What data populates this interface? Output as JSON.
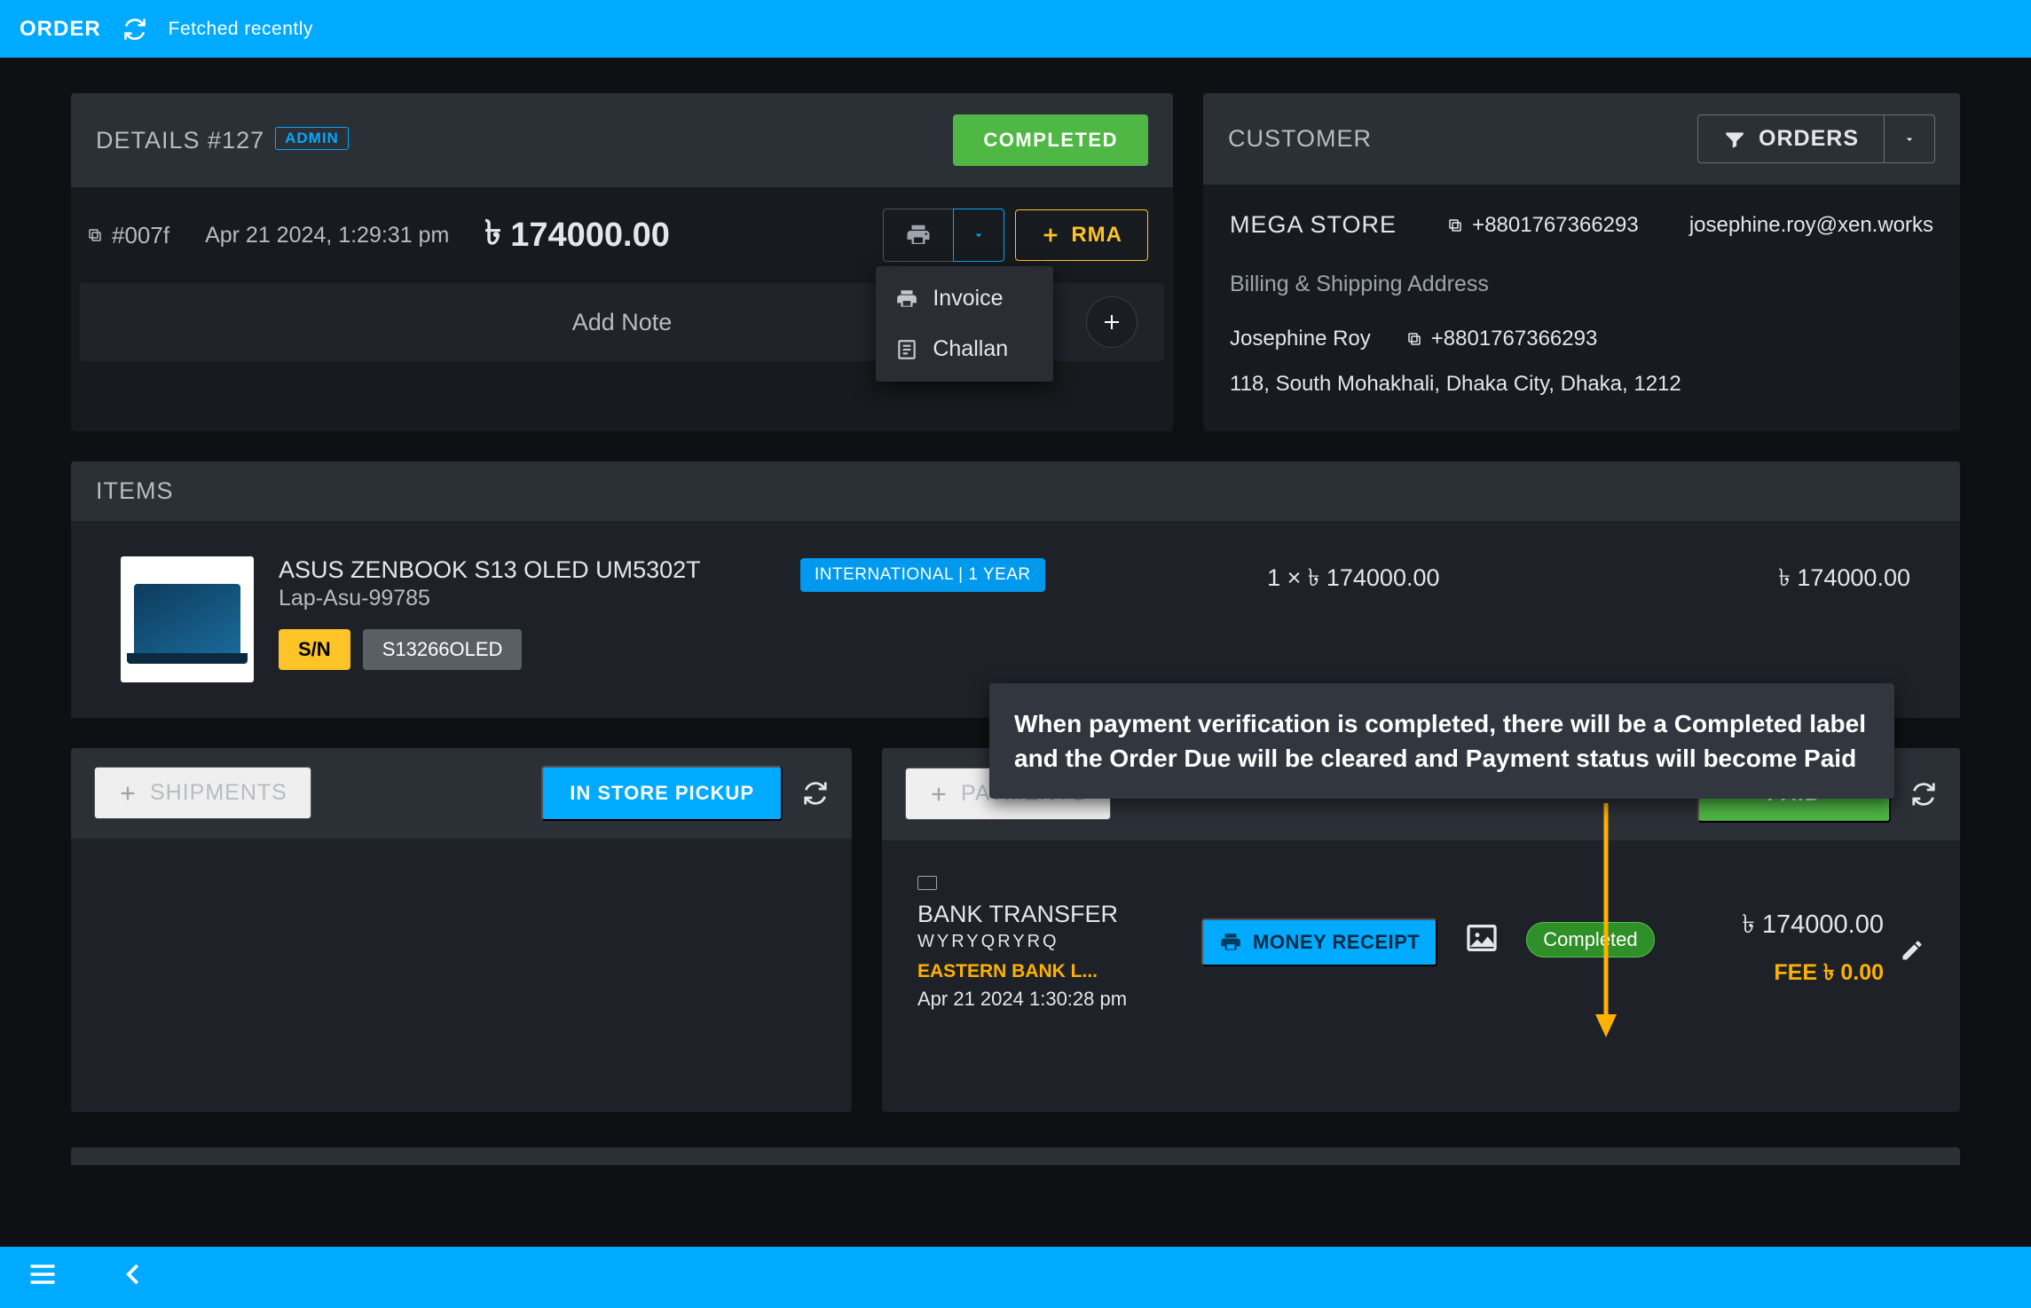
{
  "topbar": {
    "title": "ORDER",
    "fetched_label": "Fetched recently"
  },
  "details": {
    "title": "DETAILS #127",
    "admin_badge": "ADMIN",
    "completed_label": "COMPLETED",
    "hash": "#007f",
    "datetime": "Apr 21 2024, 1:29:31 pm",
    "total": "174000.00",
    "rma_label": "RMA",
    "add_note_label": "Add Note",
    "dropdown": {
      "invoice": "Invoice",
      "challan": "Challan"
    }
  },
  "customer": {
    "title": "CUSTOMER",
    "orders_btn": "ORDERS",
    "store_name": "MEGA STORE",
    "phone1": "+8801767366293",
    "email": "josephine.roy@xen.works",
    "section_label": "Billing & Shipping Address",
    "recipient_name": "Josephine Roy",
    "phone2": "+8801767366293",
    "address": "118, South Mohakhali, Dhaka City, Dhaka, 1212"
  },
  "items": {
    "title": "ITEMS",
    "list": [
      {
        "name": "ASUS ZENBOOK S13 OLED UM5302T",
        "sku": "Lap-Asu-99785",
        "sn_label": "S/N",
        "serial": "S13266OLED",
        "warranty": "INTERNATIONAL | 1 YEAR",
        "qty_price": "1 × ৳ 174000.00",
        "line_total": "৳ 174000.00"
      }
    ]
  },
  "annotation": "When payment verification is completed, there will be a Completed label and the Order Due will be cleared and Payment status will become Paid",
  "shipments": {
    "title": "SHIPMENTS",
    "pickup_label": "IN STORE PICKUP"
  },
  "payments": {
    "title": "PAYMENTS",
    "paid_label": "PAID",
    "entry": {
      "method": "BANK TRANSFER",
      "reference": "WYRYQRYRQ",
      "bank": "EASTERN BANK L...",
      "datetime": "Apr 21 2024 1:30:28 pm",
      "money_receipt_label": "MONEY RECEIPT",
      "status_chip": "Completed",
      "amount": "৳ 174000.00",
      "fee": "FEE ৳ 0.00"
    }
  }
}
